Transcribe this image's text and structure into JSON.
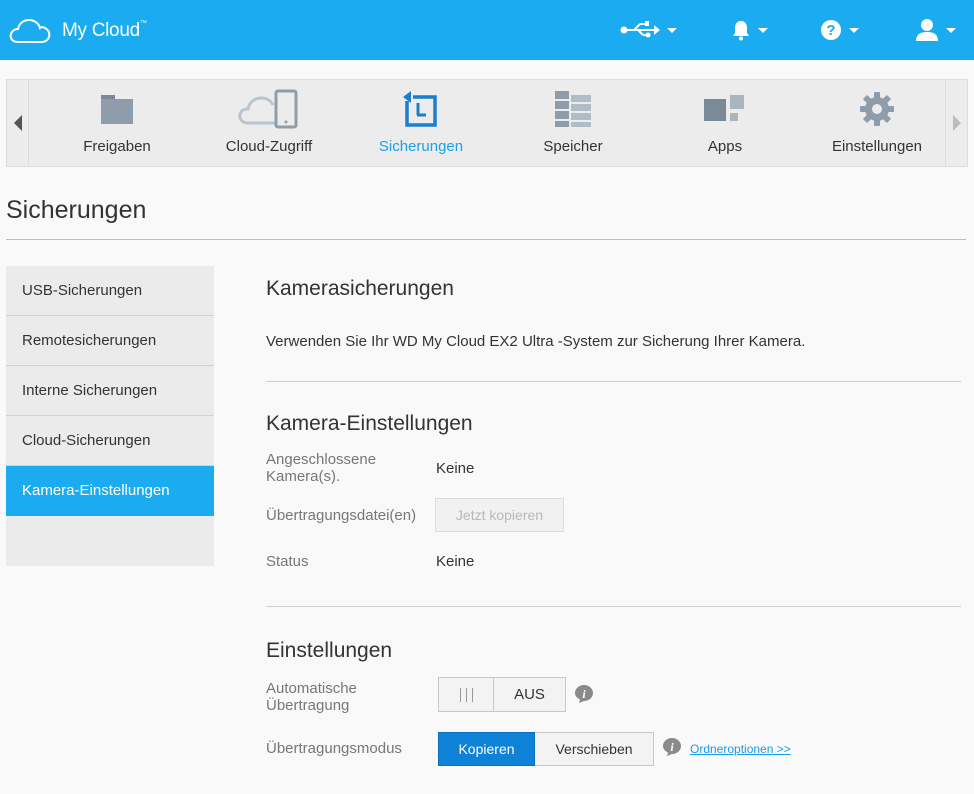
{
  "header": {
    "app_name": "My Cloud",
    "trademark": "™"
  },
  "nav": {
    "items": [
      {
        "label": "Freigaben",
        "icon": "folder-icon"
      },
      {
        "label": "Cloud-Zugriff",
        "icon": "cloud-device-icon"
      },
      {
        "label": "Sicherungen",
        "icon": "backup-icon",
        "active": true
      },
      {
        "label": "Speicher",
        "icon": "storage-icon"
      },
      {
        "label": "Apps",
        "icon": "apps-icon"
      },
      {
        "label": "Einstellungen",
        "icon": "gear-icon"
      }
    ]
  },
  "page": {
    "title": "Sicherungen"
  },
  "sidebar": {
    "items": [
      {
        "label": "USB-Sicherungen"
      },
      {
        "label": "Remotesicherungen"
      },
      {
        "label": "Interne Sicherungen"
      },
      {
        "label": "Cloud-Sicherungen"
      },
      {
        "label": "Kamera-Einstellungen",
        "active": true
      }
    ]
  },
  "main": {
    "camera_backups": {
      "heading": "Kamerasicherungen",
      "description": "Verwenden Sie Ihr WD My Cloud EX2 Ultra -System zur Sicherung Ihrer Kamera."
    },
    "camera_settings": {
      "heading": "Kamera-Einstellungen",
      "connected_label_1": "Angeschlossene",
      "connected_label_2": "Kamera(s).",
      "connected_value": "Keine",
      "transfer_label": "Übertragungsdatei(en)",
      "copy_now_button": "Jetzt kopieren",
      "status_label": "Status",
      "status_value": "Keine"
    },
    "settings": {
      "heading": "Einstellungen",
      "auto_label_1": "Automatische",
      "auto_label_2": "Übertragung",
      "auto_toggle_state": "AUS",
      "mode_label": "Übertragungsmodus",
      "mode_copy": "Kopieren",
      "mode_move": "Verschieben",
      "folder_options_link": "Ordneroptionen >>"
    }
  },
  "colors": {
    "brand_blue": "#1aabf0",
    "primary_button": "#0d82d6"
  }
}
